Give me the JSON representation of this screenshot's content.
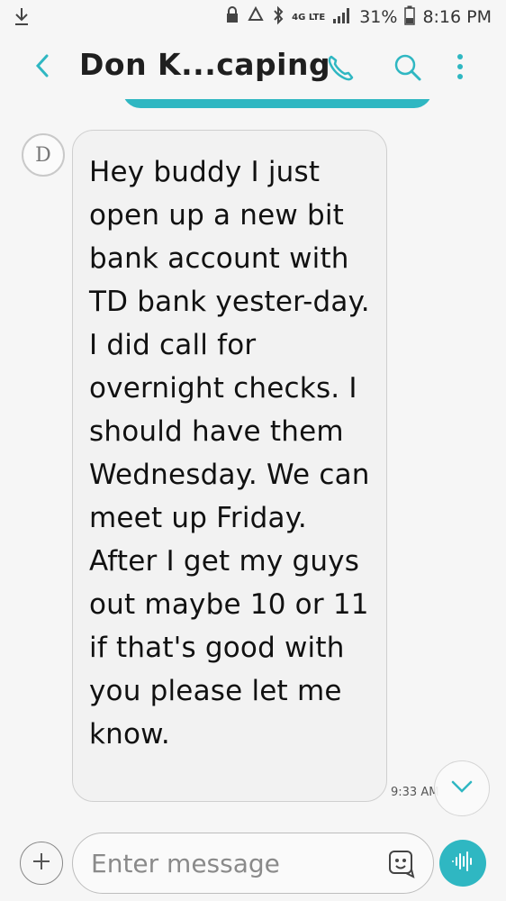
{
  "status_bar": {
    "battery_percent": "31%",
    "time": "8:16 PM",
    "network": "4G LTE",
    "icons": [
      "download-icon",
      "lock-icon",
      "recycle-icon",
      "bluetooth-icon",
      "signal-icon",
      "battery-icon"
    ]
  },
  "header": {
    "title": "Don K...caping",
    "icons": [
      "back-icon",
      "phone-icon",
      "search-icon",
      "more-icon"
    ]
  },
  "conversation": {
    "avatar_letter": "D",
    "message_text": "Hey buddy I just open up a new bit bank account with TD bank yester-day. I did call for overnight checks. I should have them Wednesday. We can meet up Friday. After I get my guys out maybe 10 or 11 if that's good with you please let me know.",
    "message_time": "9:33 AM"
  },
  "compose": {
    "placeholder": "Enter message"
  },
  "colors": {
    "accent": "#2fb7c2",
    "bubble_bg": "#f2f2f2"
  }
}
